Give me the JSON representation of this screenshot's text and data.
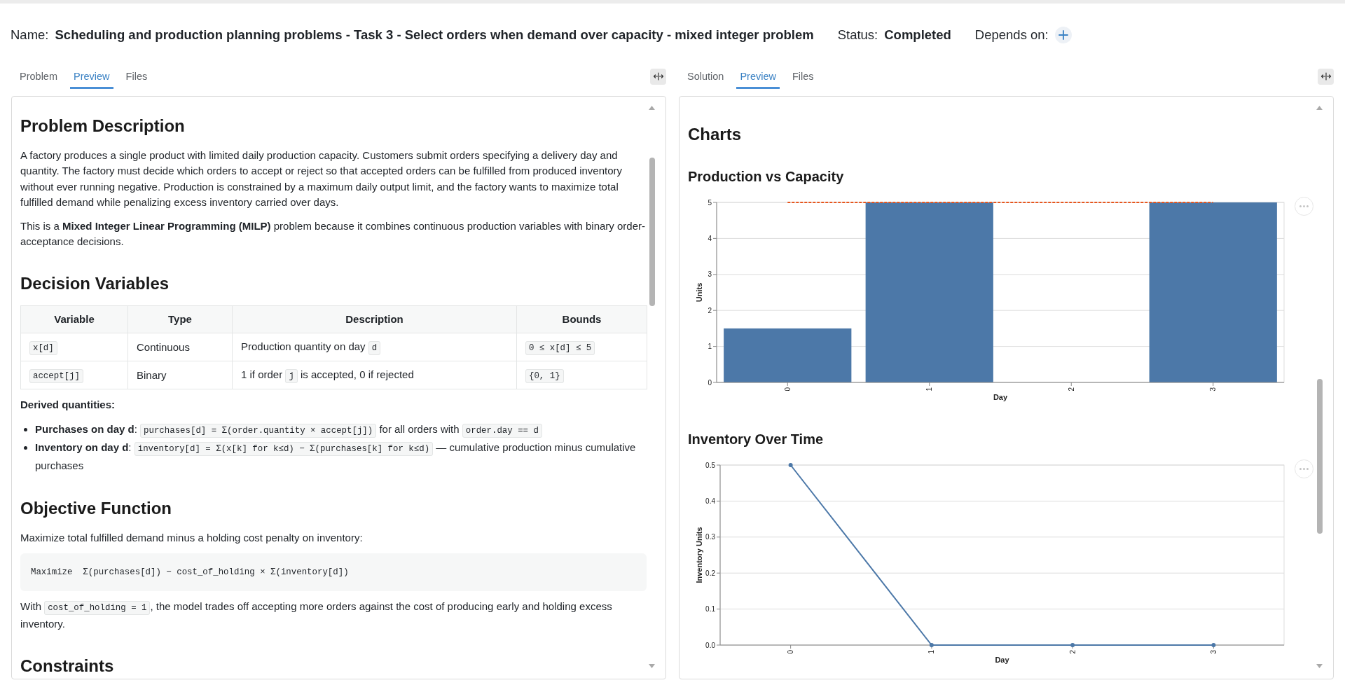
{
  "header": {
    "name_label": "Name:",
    "name": "Scheduling and production planning problems - Task 3 - Select orders when demand over capacity - mixed integer problem",
    "status_label": "Status:",
    "status": "Completed",
    "depends_label": "Depends on:"
  },
  "left_panel": {
    "tabs": [
      {
        "label": "Problem",
        "selected": false
      },
      {
        "label": "Preview",
        "selected": true
      },
      {
        "label": "Files",
        "selected": false
      }
    ],
    "content": [
      {
        "kind": "heading",
        "text": "Problem Description"
      },
      {
        "kind": "paragraph",
        "segments": [
          {
            "kind": "text",
            "text": "A factory produces a single product with limited daily production capacity. Customers submit orders specifying a delivery day and quantity. The factory must decide which orders to accept or reject so that accepted orders can be fulfilled from produced inventory without ever running negative. Production is constrained by a maximum daily output limit, and the factory wants to maximize total fulfilled demand while penalizing excess inventory carried over days."
          }
        ]
      },
      {
        "kind": "paragraph",
        "segments": [
          {
            "kind": "text",
            "text": "This is a **Mixed Integer Linear Programming (MILP)** problem because it combines continuous production variables with binary order-acceptance decisions."
          }
        ]
      },
      {
        "kind": "heading",
        "text": "Decision Variables"
      },
      {
        "kind": "table",
        "columns": [
          "Variable",
          "Type",
          "Description",
          "Bounds"
        ],
        "rows": [
          [
            [
              {
                "kind": "code",
                "text": "x[d]"
              }
            ],
            [
              {
                "kind": "text",
                "text": "Continuous"
              }
            ],
            [
              {
                "kind": "text",
                "text": "Production quantity on day "
              },
              {
                "kind": "code",
                "text": "d"
              }
            ],
            [
              {
                "kind": "code",
                "text": "0 ≤ x[d] ≤ 5"
              }
            ]
          ],
          [
            [
              {
                "kind": "code",
                "text": "accept[j]"
              }
            ],
            [
              {
                "kind": "text",
                "text": "Binary"
              }
            ],
            [
              {
                "kind": "text",
                "text": "1 if order "
              },
              {
                "kind": "code",
                "text": "j"
              },
              {
                "kind": "text",
                "text": " is accepted, 0 if rejected"
              }
            ],
            [
              {
                "kind": "code",
                "text": "{0, 1}"
              }
            ]
          ]
        ]
      },
      {
        "kind": "label",
        "text": "Derived quantities:"
      },
      {
        "kind": "bullets",
        "items": [
          {
            "segments": [
              {
                "kind": "text",
                "text": "**Purchases on day d**: "
              },
              {
                "kind": "code",
                "text": "purchases[d] = Σ(order.quantity × accept[j])"
              },
              {
                "kind": "text",
                "text": " for all orders with "
              },
              {
                "kind": "code",
                "text": "order.day == d"
              }
            ]
          },
          {
            "segments": [
              {
                "kind": "text",
                "text": "**Inventory on day d**: "
              },
              {
                "kind": "code",
                "text": "inventory[d] = Σ(x[k] for k≤d) − Σ(purchases[k] for k≤d)"
              },
              {
                "kind": "text",
                "text": " — cumulative production minus cumulative purchases"
              }
            ]
          }
        ]
      },
      {
        "kind": "heading",
        "text": "Objective Function"
      },
      {
        "kind": "paragraph",
        "segments": [
          {
            "kind": "text",
            "text": "Maximize total fulfilled demand minus a holding cost penalty on inventory:"
          }
        ]
      },
      {
        "kind": "code_block",
        "text": "Maximize  Σ(purchases[d]) − cost_of_holding × Σ(inventory[d])"
      },
      {
        "kind": "paragraph",
        "segments": [
          {
            "kind": "text",
            "text": "With "
          },
          {
            "kind": "code",
            "text": "cost_of_holding = 1"
          },
          {
            "kind": "text",
            "text": ", the model trades off accepting more orders against the cost of producing early and holding excess inventory."
          }
        ]
      },
      {
        "kind": "heading",
        "text": "Constraints"
      }
    ]
  },
  "right_panel": {
    "tabs": [
      {
        "label": "Solution",
        "selected": false
      },
      {
        "label": "Preview",
        "selected": true
      },
      {
        "label": "Files",
        "selected": false
      }
    ],
    "content": [
      {
        "kind": "heading",
        "text": "Charts"
      },
      {
        "kind": "chart",
        "chart_data": {
          "type": "bar",
          "title": "Production vs Capacity",
          "xlabel": "Day",
          "ylabel": "Units",
          "categories": [
            "0",
            "1",
            "2",
            "3"
          ],
          "series": [
            {
              "color": "#4c78a8",
              "values": [
                1.5,
                5,
                0,
                5
              ]
            },
            {
              "type": "line",
              "color": "#e8561d",
              "line_style": "dashed",
              "values": [
                5,
                5,
                5,
                5
              ]
            }
          ],
          "ylim": [
            0,
            5
          ],
          "yticks": [
            0,
            1,
            2,
            3,
            4,
            5
          ],
          "grid": true
        }
      },
      {
        "kind": "chart",
        "chart_data": {
          "type": "line",
          "title": "Inventory Over Time",
          "xlabel": "Day",
          "ylabel": "Inventory Units",
          "categories": [
            "0",
            "1",
            "2",
            "3"
          ],
          "series": [
            {
              "color": "#4c78a8",
              "marker": true,
              "values": [
                0.5,
                0,
                0,
                0
              ]
            }
          ],
          "ylim": [
            0,
            0.5
          ],
          "yticks": [
            {
              "value": 0,
              "label": "0.0"
            },
            {
              "value": 0.1,
              "label": "0.1"
            },
            {
              "value": 0.2,
              "label": "0.2"
            },
            {
              "value": 0.3,
              "label": "0.3"
            },
            {
              "value": 0.4,
              "label": "0.4"
            },
            {
              "value": 0.5,
              "label": "0.5"
            }
          ],
          "grid": true
        }
      }
    ]
  }
}
